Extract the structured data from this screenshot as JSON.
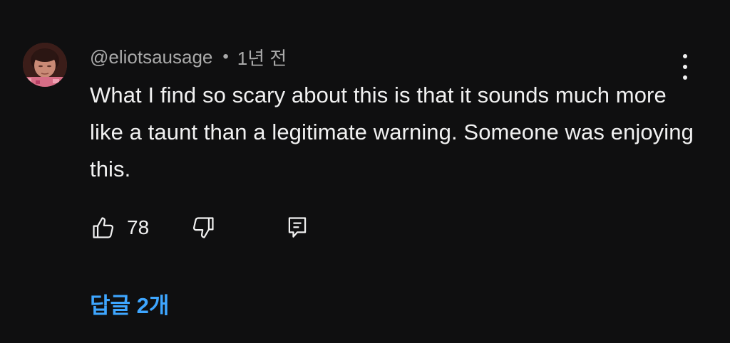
{
  "comment": {
    "author": "@eliotsausage",
    "separator": "•",
    "time": "1년 전",
    "text": "What I find so scary about this is that it sounds much more like a taunt than a legitimate warning. Someone was enjoying this.",
    "avatar_icon": "user-avatar-photo",
    "menu_icon": "more-vertical-icon"
  },
  "actions": {
    "like_icon": "thumbs-up-icon",
    "like_count": "78",
    "dislike_icon": "thumbs-down-icon",
    "reply_icon": "reply-comment-icon"
  },
  "replies": {
    "label": "답글 2개"
  },
  "colors": {
    "background": "#0f0f10",
    "text_primary": "#f1f1f1",
    "text_secondary": "#aaaaaa",
    "link": "#3ea6ff"
  }
}
